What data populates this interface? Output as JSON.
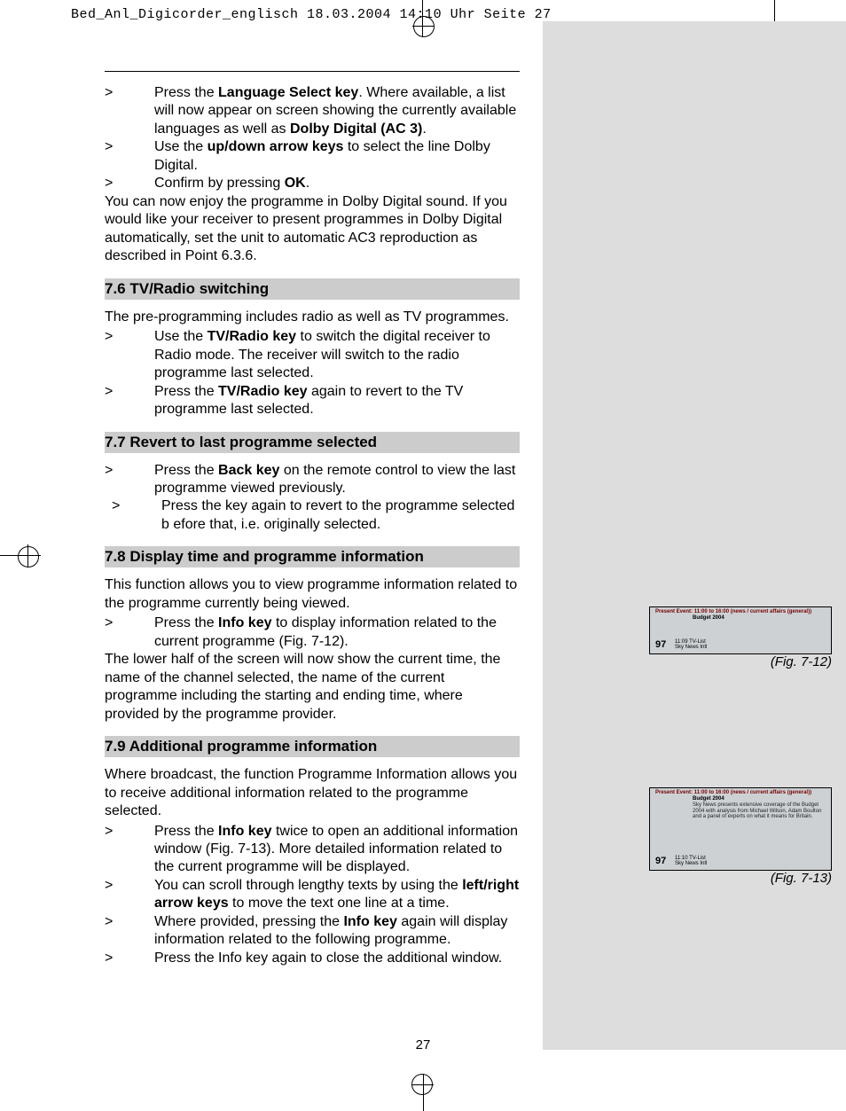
{
  "header": "Bed_Anl_Digicorder_englisch  18.03.2004  14:10 Uhr  Seite 27",
  "page_number": "27",
  "intro": {
    "b1": {
      "pre": "Press the ",
      "bold1": "Language Select key",
      "mid": ". Where available, a list will now appear on screen showing the currently available languages as well as ",
      "bold2": "Dolby Digital (AC 3)",
      "post": "."
    },
    "b2": {
      "pre": "Use the ",
      "bold1": "up/down arrow keys",
      "post": " to select the line Dolby Digital."
    },
    "b3": {
      "pre": "Confirm by pressing ",
      "bold1": "OK",
      "post": "."
    },
    "para": "You can now enjoy the programme in Dolby Digital sound. If you would like your receiver to present programmes in Dolby Digital automatically, set the unit to automatic AC3 reproduction as described in Point 6.3.6."
  },
  "s76": {
    "heading": "7.6 TV/Radio switching",
    "para": "The pre-programming includes radio as well as TV programmes.",
    "b1": {
      "pre": "Use the ",
      "bold1": "TV/Radio key",
      "post": " to switch the digital receiver to Radio mode. The receiver will switch to the radio programme last selected."
    },
    "b2": {
      "pre": "Press the ",
      "bold1": "TV/Radio key",
      "post": " again to revert to the TV programme last selected."
    }
  },
  "s77": {
    "heading": "7.7 Revert to last programme selected",
    "b1": {
      "pre": "Press the ",
      "bold1": "Back key",
      "post": " on the remote control to view the last programme viewed previously."
    },
    "b2": {
      "text": "Press the key again to revert to the programme selected b efore that, i.e. originally selected."
    }
  },
  "s78": {
    "heading": "7.8 Display time and programme information",
    "para1": "This function allows you to view programme information related to the programme currently being viewed.",
    "b1": {
      "pre": "Press the ",
      "bold1": "Info key",
      "post": " to display information related to the current programme (Fig. 7-12)."
    },
    "para2": "The lower half of the screen will now show the current time, the name of the channel selected, the name of the current programme including the starting and ending time, where provided by the programme provider."
  },
  "s79": {
    "heading": "7.9 Additional programme information",
    "para": "Where broadcast, the function Programme Information allows you to receive additional information related to the programme selected.",
    "b1": {
      "pre": "Press the ",
      "bold1": "Info key",
      "post": " twice to open an additional information window (Fig. 7-13). More detailed information related to the current programme will be displayed."
    },
    "b2": {
      "pre": "You can scroll through lengthy texts by using the ",
      "bold1": "left/right arrow keys",
      "post": " to move the text one line at a time."
    },
    "b3": {
      "pre": "Where provided, pressing the ",
      "bold1": "Info key",
      "post": " again will display information related to the following programme."
    },
    "b4": {
      "text": "Press the Info key again to close the additional window."
    }
  },
  "fig12": {
    "caption": "(Fig. 7-12)",
    "line1": "Present Event:  11:00 to 16:00 (news / current affairs (general))",
    "line2": "Budget 2004",
    "ch": "97",
    "chinfo1": "11:09  TV-List",
    "chinfo2": "Sky News Intl"
  },
  "fig13": {
    "caption": "(Fig. 7-13)",
    "line1": "Present Event:  11:00 to 16:00 (news / current affairs (general))",
    "line2": "Budget 2004",
    "desc": "Sky News presents extensive coverage of the Budget 2004 with analysis from Michael Wilson, Adam Boulton and a panel of experts on what it means for Britain.",
    "ch": "97",
    "chinfo1": "11:10  TV-List",
    "chinfo2": "Sky News Intl"
  },
  "marker": ">"
}
